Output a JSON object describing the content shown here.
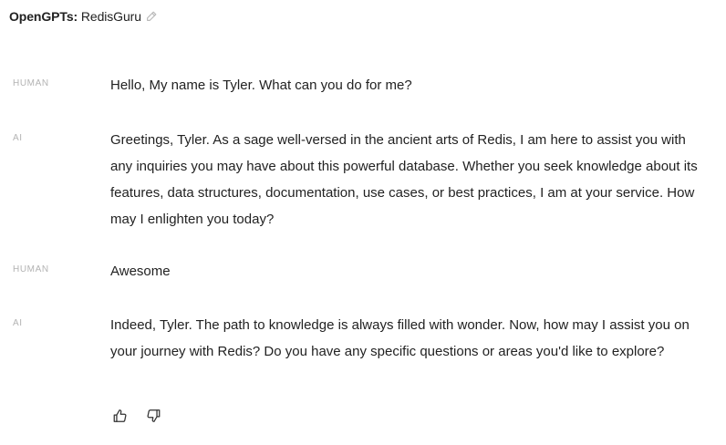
{
  "header": {
    "prefix": "OpenGPTs:",
    "gpt_name": "RedisGuru",
    "edit_icon": "pencil-icon"
  },
  "messages": [
    {
      "role": "HUMAN",
      "text": "Hello, My name is Tyler. What can you do for me?"
    },
    {
      "role": "AI",
      "text": "Greetings, Tyler. As a sage well-versed in the ancient arts of Redis, I am here to assist you with any inquiries you may have about this powerful database. Whether you seek knowledge about its features, data structures, documentation, use cases, or best practices, I am at your service. How may I enlighten you today?"
    },
    {
      "role": "HUMAN",
      "text": "Awesome"
    },
    {
      "role": "AI",
      "text": "Indeed, Tyler. The path to knowledge is always filled with wonder. Now, how may I assist you on your journey with Redis? Do you have any specific questions or areas you'd like to explore?"
    }
  ],
  "feedback": {
    "thumbs_up_icon": "thumbs-up-icon",
    "thumbs_down_icon": "thumbs-down-icon"
  }
}
